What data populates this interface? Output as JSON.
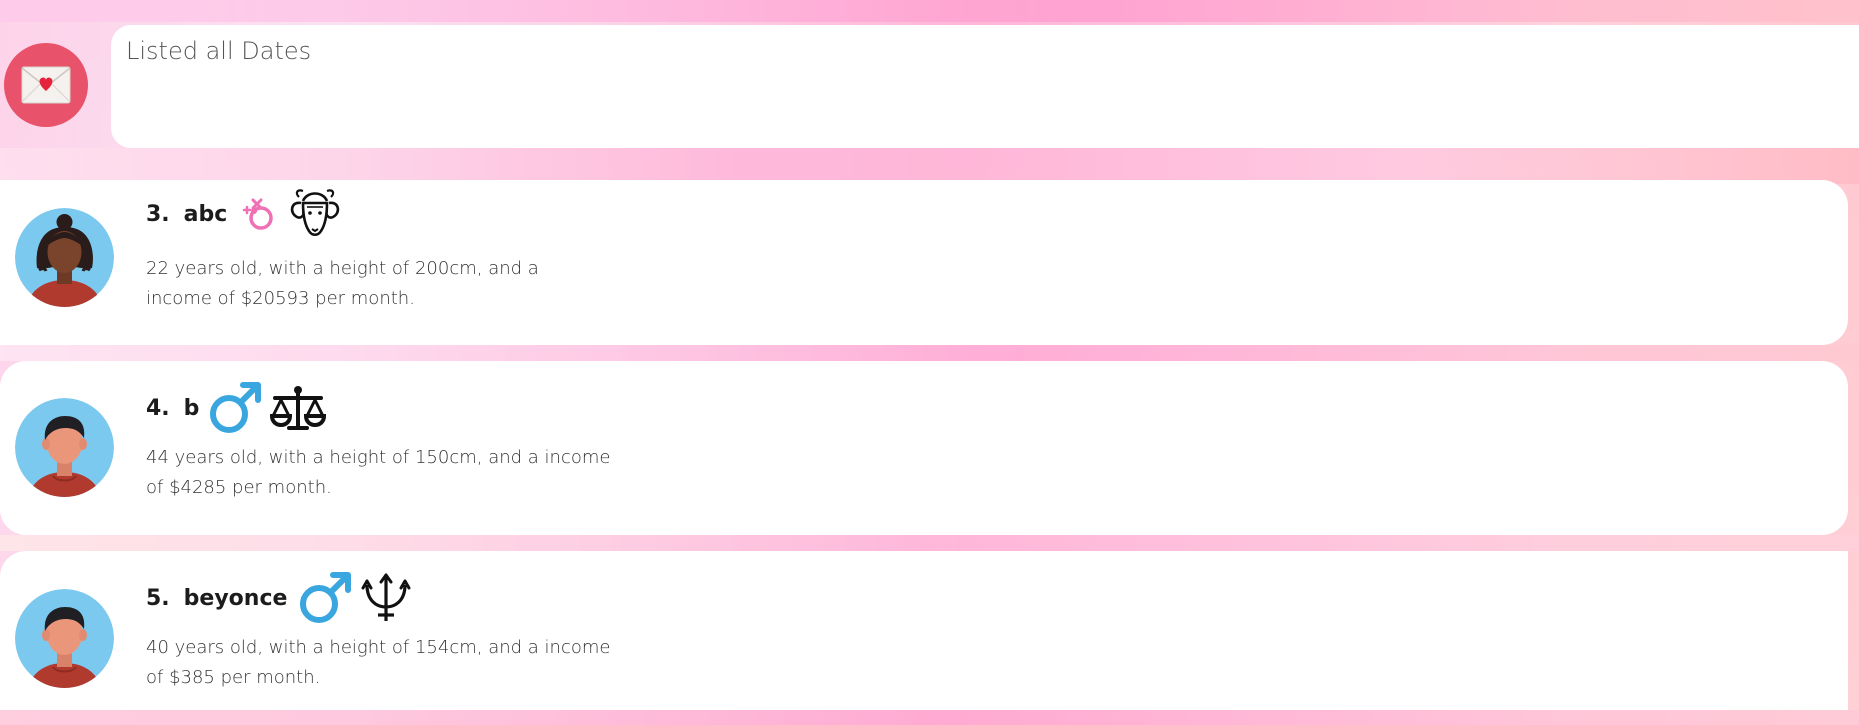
{
  "result_display": {
    "text": "Listed all Dates"
  },
  "app_icon": "love-letter-icon",
  "colors": {
    "app_icon_bg": "#e8526a",
    "male_symbol": "#3aa6e0",
    "female_symbol": "#f06fb5",
    "avatar_bg": "#7cc9ef",
    "shirt": "#b03a2e"
  },
  "dates": [
    {
      "index": "3.",
      "name": "abc",
      "gender_icon": "female-symbol-icon",
      "horoscope_icon": "aries-icon",
      "description": "22 years old, with a height of 200cm, and a income of $20593 per month."
    },
    {
      "index": "4.",
      "name": "b",
      "gender_icon": "male-symbol-icon",
      "horoscope_icon": "libra-icon",
      "description": "44 years old, with a height of 150cm, and a income of $4285 per month."
    },
    {
      "index": "5.",
      "name": "beyonce",
      "gender_icon": "male-symbol-icon",
      "horoscope_icon": "pisces-neptune-icon",
      "description": "40 years old, with a height of 154cm, and a income of $385 per month."
    }
  ]
}
